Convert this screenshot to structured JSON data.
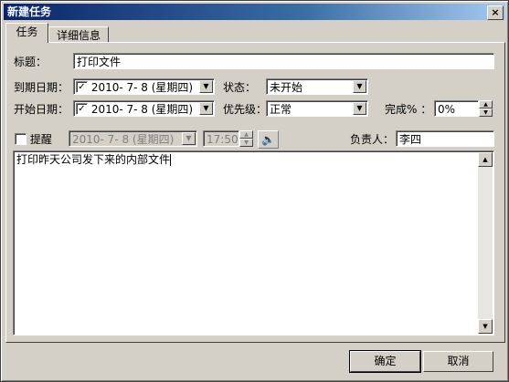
{
  "window": {
    "title": "新建任务",
    "close_glyph": "×"
  },
  "tabs": [
    {
      "label": "任务"
    },
    {
      "label": "详细信息"
    }
  ],
  "form": {
    "subject_label": "标题：",
    "subject_value": "打印文件",
    "due_label": "到期日期：",
    "due_checked": true,
    "due_value": "2010- 7- 8 (星期四)",
    "status_label": "状态：",
    "status_value": "未开始",
    "start_label": "开始日期：",
    "start_checked": true,
    "start_value": "2010- 7- 8 (星期四)",
    "priority_label": "优先级：",
    "priority_value": "正常",
    "complete_label": "完成% ：",
    "complete_value": "0%",
    "reminder_label": "提醒",
    "reminder_date": "2010- 7- 8 (星期四)",
    "reminder_time": "17:50",
    "owner_label": "负责人：",
    "owner_value": "李四",
    "notes": "打印昨天公司发下来的内部文件"
  },
  "buttons": {
    "ok": "确定",
    "cancel": "取消"
  },
  "icons": {
    "dropdown": "▼",
    "spin_up": "▲",
    "spin_down": "▼",
    "check": "✓",
    "speaker": "🔈"
  }
}
